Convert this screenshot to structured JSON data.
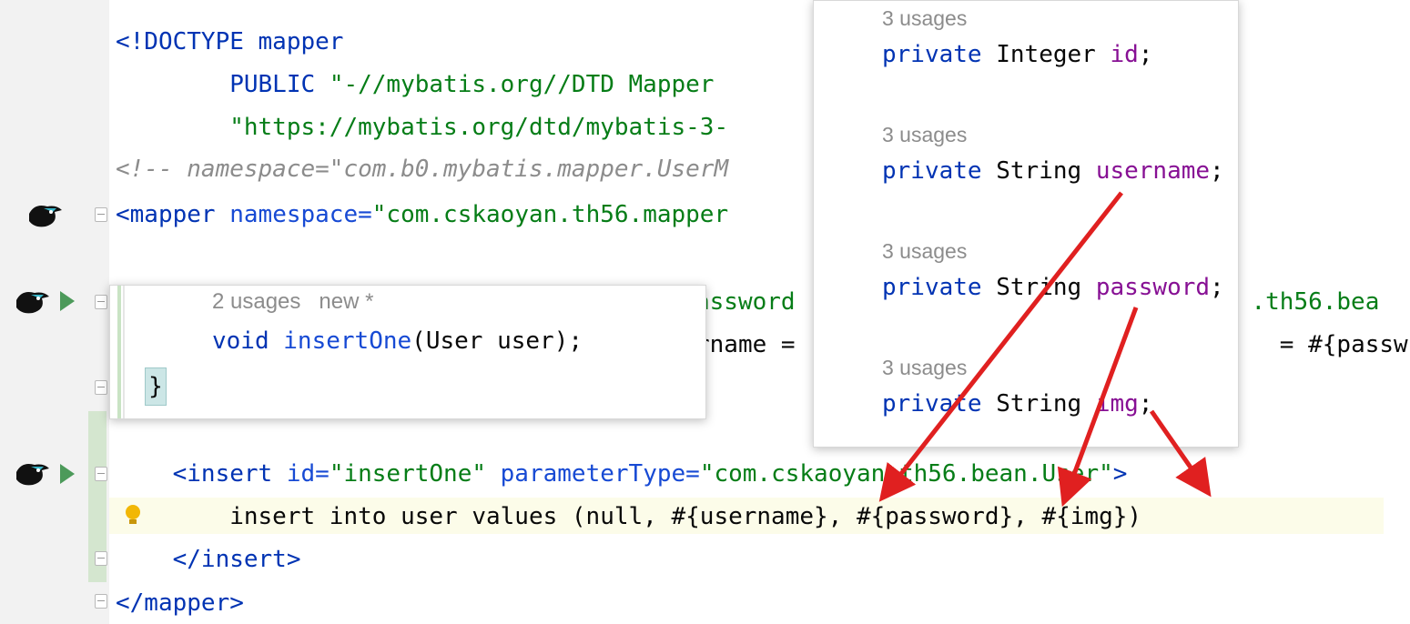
{
  "editor": {
    "lines": [
      {
        "id": "doctype",
        "parts": [
          {
            "c": "tag",
            "t": "<!DOCTYPE mapper"
          }
        ]
      },
      {
        "id": "public",
        "parts": [
          {
            "c": "tag",
            "t": "        PUBLIC "
          },
          {
            "c": "str",
            "t": "\"-//mybatis.org//DTD Mapper"
          }
        ]
      },
      {
        "id": "dtd-url",
        "parts": [
          {
            "c": "str",
            "t": "        \"https://mybatis.org/dtd/mybatis-3-"
          }
        ]
      },
      {
        "id": "comment",
        "parts": [
          {
            "c": "cmt",
            "t": "<!-- namespace=\"com.b0.mybatis.mapper.UserM"
          }
        ]
      },
      {
        "id": "mapper-open",
        "parts": [
          {
            "c": "tag",
            "t": "<mapper "
          },
          {
            "c": "attr",
            "t": "namespace="
          },
          {
            "c": "str",
            "t": "\"com.cskaoyan.th56.mapper"
          }
        ]
      },
      {
        "id": "hidden-1",
        "parts": [
          {
            "c": "str",
            "t": "assword"
          },
          {
            "c": "plain",
            "t": "                                "
          },
          {
            "c": "str",
            "t": ".th56.bea"
          }
        ]
      },
      {
        "id": "hidden-2",
        "parts": [
          {
            "c": "plain",
            "t": "rname = "
          },
          {
            "c": "plain",
            "t": "                                 "
          },
          {
            "c": "plain",
            "t": "= #{passw"
          }
        ]
      },
      {
        "id": "insert-open",
        "parts": [
          {
            "c": "tag",
            "t": "    <insert "
          },
          {
            "c": "attr",
            "t": "id="
          },
          {
            "c": "str",
            "t": "\"insertOne\" "
          },
          {
            "c": "attr",
            "t": "parameterType="
          },
          {
            "c": "str",
            "t": "\"com.cskaoyan.th56.bean.User\""
          },
          {
            "c": "tag",
            "t": ">"
          }
        ]
      },
      {
        "id": "insert-sql",
        "parts": [
          {
            "c": "plain",
            "t": "        insert into user values (null, #{username}, #{password}, #{img})"
          }
        ]
      },
      {
        "id": "insert-close",
        "parts": [
          {
            "c": "tag",
            "t": "    </insert>"
          }
        ]
      },
      {
        "id": "mapper-close",
        "parts": [
          {
            "c": "tag",
            "t": "</mapper>"
          }
        ]
      }
    ]
  },
  "popup_left": {
    "hint_usages": "2 usages",
    "hint_new": "new *",
    "method_parts": [
      {
        "c": "kw",
        "t": "void "
      },
      {
        "c": "attr",
        "t": "insertOne"
      },
      {
        "c": "plain",
        "t": "(User user);"
      }
    ],
    "brace": "}"
  },
  "popup_right": {
    "fields": [
      {
        "usages": "3 usages",
        "modifier": "private",
        "type": "Integer",
        "name": "id"
      },
      {
        "usages": "3 usages",
        "modifier": "private",
        "type": "String",
        "name": "username"
      },
      {
        "usages": "3 usages",
        "modifier": "private",
        "type": "String",
        "name": "password"
      },
      {
        "usages": "3 usages",
        "modifier": "private",
        "type": "String",
        "name": "img"
      }
    ]
  },
  "gutter": {
    "icons": [
      "mybatis-bird-icon",
      "run-icon",
      "fold-icon",
      "bulb-icon"
    ]
  },
  "colors": {
    "tag": "#0033b3",
    "string": "#067d17",
    "comment": "#8c8c8c",
    "field": "#871094",
    "arrow": "#e02020",
    "run": "#4c9a5a"
  }
}
